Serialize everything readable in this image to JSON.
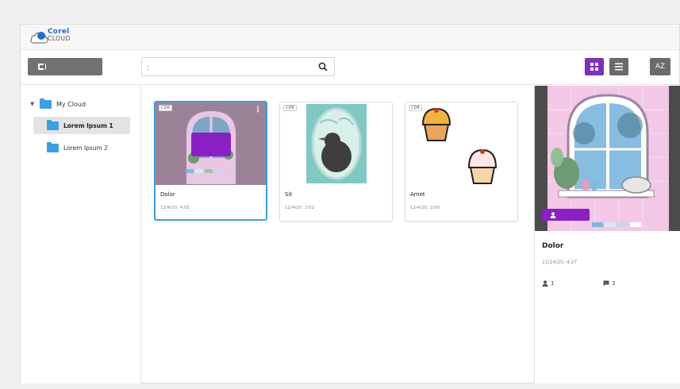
{
  "app": {
    "brand": "Corel",
    "brand_sub": "CLOUD"
  },
  "toolbar": {
    "search_placeholder": ":",
    "sort_label": "AZ"
  },
  "sidebar": {
    "root_label": "My Cloud",
    "items": [
      {
        "label": "Lorem Ipsum 1",
        "active": true
      },
      {
        "label": "Lorem Ipsum 2",
        "active": false
      }
    ]
  },
  "files": [
    {
      "badge": "CDR",
      "title": "Dolor",
      "date": "12/4/20, 4:05",
      "selected": true
    },
    {
      "badge": "CDR",
      "title": "Sit",
      "date": "12/4/20, 3:02",
      "selected": false
    },
    {
      "badge": "CDR",
      "title": "Amet",
      "date": "12/4/20, 3:00",
      "selected": false
    }
  ],
  "details": {
    "title": "Dolor",
    "date": "11/24/20, 4:27",
    "users_count": "1",
    "comments_count": "3"
  },
  "colors": {
    "accent_purple": "#7c2fc0",
    "selection_blue": "#3aa0e6",
    "folder_blue": "#3aa0e6"
  }
}
